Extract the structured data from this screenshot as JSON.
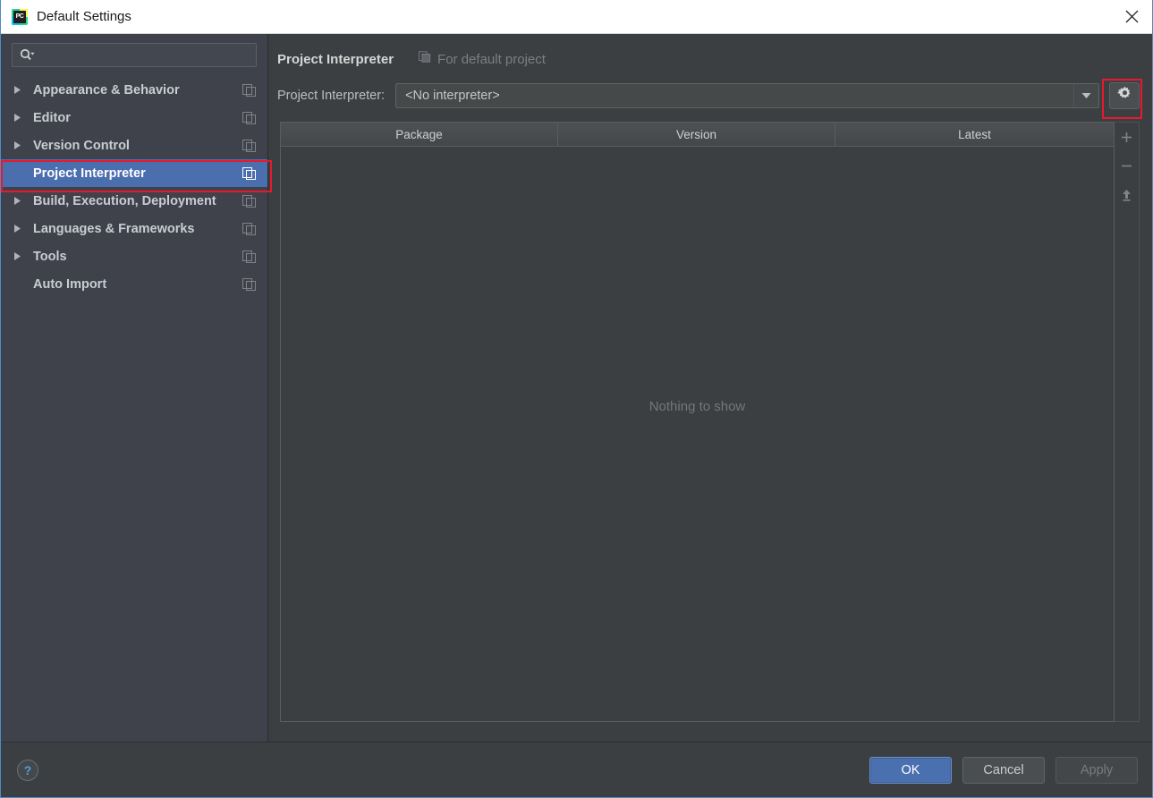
{
  "window": {
    "title": "Default Settings",
    "app_icon": "pycharm-icon",
    "icon_text": "PC",
    "close_label": "×"
  },
  "sidebar": {
    "search": {
      "value": "",
      "placeholder": "",
      "icon": "search-icon"
    },
    "items": [
      {
        "label": "Appearance & Behavior",
        "expandable": true,
        "selected": false,
        "copy_icon": "copy-settings-icon"
      },
      {
        "label": "Editor",
        "expandable": true,
        "selected": false,
        "copy_icon": "copy-settings-icon"
      },
      {
        "label": "Version Control",
        "expandable": true,
        "selected": false,
        "copy_icon": "copy-settings-icon"
      },
      {
        "label": "Project Interpreter",
        "expandable": false,
        "selected": true,
        "copy_icon": "copy-settings-icon"
      },
      {
        "label": "Build, Execution, Deployment",
        "expandable": true,
        "selected": false,
        "copy_icon": "copy-settings-icon"
      },
      {
        "label": "Languages & Frameworks",
        "expandable": true,
        "selected": false,
        "copy_icon": "copy-settings-icon"
      },
      {
        "label": "Tools",
        "expandable": true,
        "selected": false,
        "copy_icon": "copy-settings-icon"
      },
      {
        "label": "Auto Import",
        "expandable": false,
        "selected": false,
        "copy_icon": "copy-settings-icon"
      }
    ]
  },
  "main": {
    "title": "Project Interpreter",
    "scope_note": "For default project",
    "scope_icon": "copy-settings-icon",
    "interpreter": {
      "label": "Project Interpreter:",
      "value": "<No interpreter>",
      "dropdown_icon": "chevron-down-icon",
      "gear_icon": "gear-icon"
    },
    "packages_table": {
      "columns": [
        "Package",
        "Version",
        "Latest"
      ],
      "rows": [],
      "empty_message": "Nothing to show"
    },
    "table_toolbar": [
      {
        "name": "add-package-button",
        "icon": "plus-icon"
      },
      {
        "name": "remove-package-button",
        "icon": "minus-icon"
      },
      {
        "name": "upgrade-package-button",
        "icon": "arrow-up-icon"
      }
    ]
  },
  "footer": {
    "help_label": "?",
    "ok_label": "OK",
    "cancel_label": "Cancel",
    "apply_label": "Apply"
  },
  "colors": {
    "accent_selection": "#4b6eaf",
    "primary_button": "#4a70b0",
    "annotation": "#e8192c",
    "panel_bg": "#3c3f41",
    "sidebar_bg": "#3f424a"
  }
}
